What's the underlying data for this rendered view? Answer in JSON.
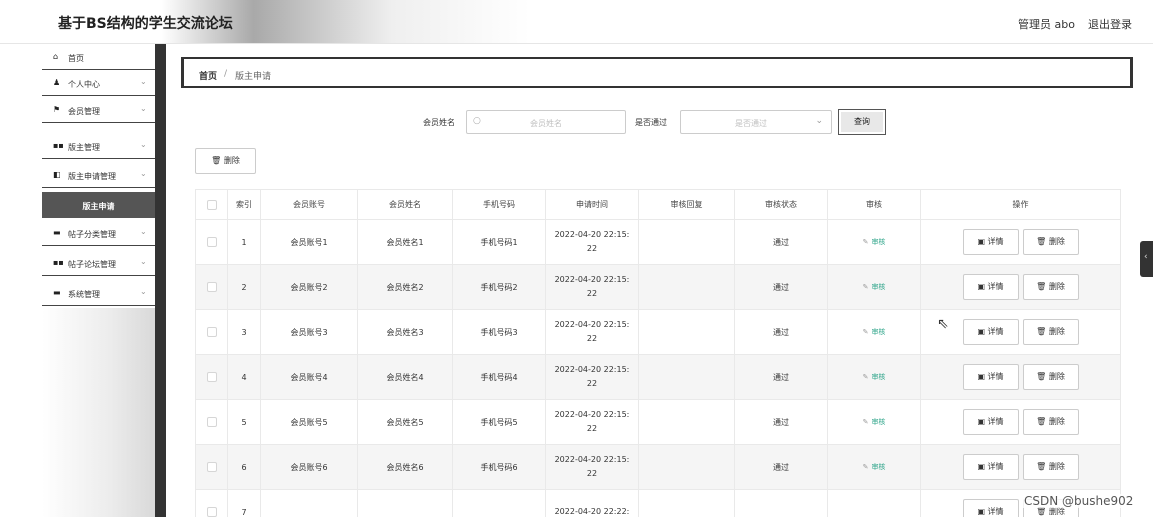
{
  "header": {
    "title": "基于BS结构的学生交流论坛",
    "admin": "管理员 abo",
    "logout": "退出登录"
  },
  "sidebar": {
    "items": [
      {
        "icon": "home-icon",
        "glyph": "⌂",
        "label": "首页",
        "chevron": ""
      },
      {
        "icon": "user-icon",
        "glyph": "♟",
        "label": "个人中心",
        "chevron": "⌄"
      },
      {
        "icon": "flag-icon",
        "glyph": "⚑",
        "label": "会员管理",
        "chevron": "⌄"
      },
      {
        "icon": "grid-icon",
        "glyph": "▪▪",
        "label": "版主管理",
        "chevron": "⌄"
      },
      {
        "icon": "board-icon",
        "glyph": "◧",
        "label": "版主申请管理",
        "chevron": "⌄"
      },
      {
        "icon": "",
        "glyph": "",
        "label": "版主申请",
        "chevron": "",
        "active": true
      },
      {
        "icon": "bookmark-icon",
        "glyph": "▬",
        "label": "帖子分类管理",
        "chevron": "⌄"
      },
      {
        "icon": "grid-icon",
        "glyph": "▪▪",
        "label": "帖子论坛管理",
        "chevron": "⌄"
      },
      {
        "icon": "monitor-icon",
        "glyph": "▬",
        "label": "系统管理",
        "chevron": "⌄"
      }
    ]
  },
  "breadcrumb": {
    "home": "首页",
    "separator": "/",
    "current": "版主申请"
  },
  "search": {
    "name_label": "会员姓名",
    "name_placeholder": "会员姓名",
    "pass_label": "是否通过",
    "pass_placeholder": "是否通过",
    "query_button": "查询"
  },
  "toolbar": {
    "delete_button": "删除"
  },
  "table": {
    "columns": [
      "",
      "索引",
      "会员账号",
      "会员姓名",
      "手机号码",
      "申请时间",
      "审核回复",
      "审核状态",
      "审核",
      "操作"
    ],
    "rows": [
      {
        "index": "1",
        "account": "会员账号1",
        "name": "会员姓名1",
        "phone": "手机号码1",
        "time1": "2022-04-20 22:15:",
        "time2": "22",
        "reply": "",
        "status": "通过",
        "review": "审核"
      },
      {
        "index": "2",
        "account": "会员账号2",
        "name": "会员姓名2",
        "phone": "手机号码2",
        "time1": "2022-04-20 22:15:",
        "time2": "22",
        "reply": "",
        "status": "通过",
        "review": "审核"
      },
      {
        "index": "3",
        "account": "会员账号3",
        "name": "会员姓名3",
        "phone": "手机号码3",
        "time1": "2022-04-20 22:15:",
        "time2": "22",
        "reply": "",
        "status": "通过",
        "review": "审核"
      },
      {
        "index": "4",
        "account": "会员账号4",
        "name": "会员姓名4",
        "phone": "手机号码4",
        "time1": "2022-04-20 22:15:",
        "time2": "22",
        "reply": "",
        "status": "通过",
        "review": "审核"
      },
      {
        "index": "5",
        "account": "会员账号5",
        "name": "会员姓名5",
        "phone": "手机号码5",
        "time1": "2022-04-20 22:15:",
        "time2": "22",
        "reply": "",
        "status": "通过",
        "review": "审核"
      },
      {
        "index": "6",
        "account": "会员账号6",
        "name": "会员姓名6",
        "phone": "手机号码6",
        "time1": "2022-04-20 22:15:",
        "time2": "22",
        "reply": "",
        "status": "通过",
        "review": "审核"
      },
      {
        "index": "7",
        "account": "",
        "name": "",
        "phone": "",
        "time1": "2022-04-20 22:22:",
        "time2": "",
        "reply": "",
        "status": "",
        "review": ""
      }
    ],
    "detail_button": "详情",
    "delete_button": "删除"
  },
  "watermark": "CSDN @bushe902",
  "colors": {
    "review_link": "#2fa58a",
    "sidebar_active": "#555555",
    "sidebar_dark": "#333333"
  }
}
